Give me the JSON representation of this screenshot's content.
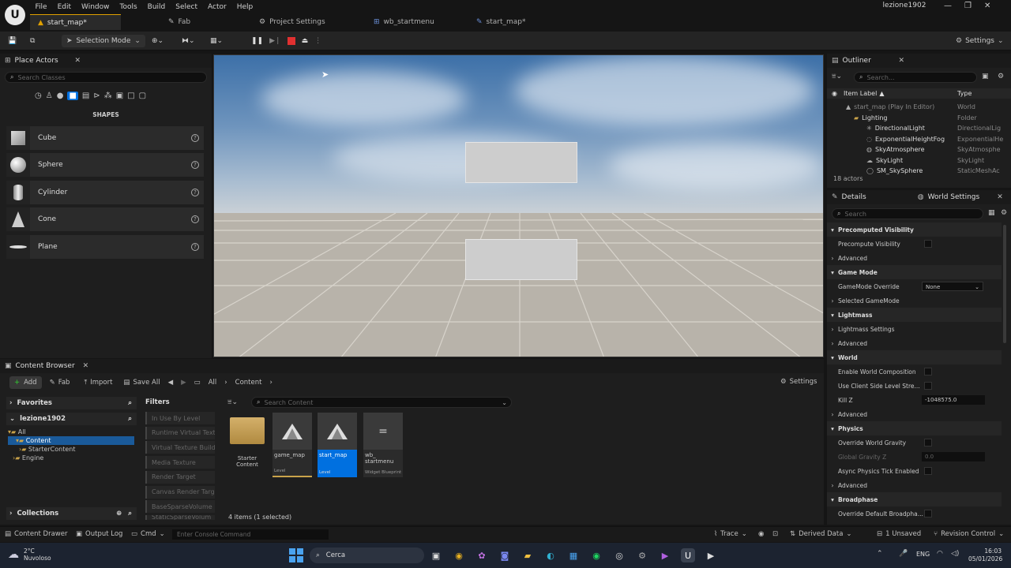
{
  "menu": [
    "File",
    "Edit",
    "Window",
    "Tools",
    "Build",
    "Select",
    "Actor",
    "Help"
  ],
  "project_name": "lezione1902",
  "tabs": [
    {
      "label": "start_map*",
      "icon": "level-icon"
    },
    {
      "label": "Fab",
      "icon": "fab-icon"
    },
    {
      "label": "Project Settings",
      "icon": "gear-icon"
    },
    {
      "label": "wb_startmenu",
      "icon": "widget-icon"
    },
    {
      "label": "start_map*",
      "icon": "level-icon"
    }
  ],
  "toolbar": {
    "selection_mode": "Selection Mode",
    "settings": "Settings"
  },
  "place_actors": {
    "title": "Place Actors",
    "search_placeholder": "Search Classes",
    "category": "SHAPES",
    "shapes": [
      "Cube",
      "Sphere",
      "Cylinder",
      "Cone",
      "Plane"
    ]
  },
  "outliner": {
    "title": "Outliner",
    "search_placeholder": "Search...",
    "col_label": "Item Label",
    "col_type": "Type",
    "rows": [
      {
        "label": "start_map (Play In Editor)",
        "type": "World"
      },
      {
        "label": "Lighting",
        "type": "Folder"
      },
      {
        "label": "DirectionalLight",
        "type": "DirectionalLig"
      },
      {
        "label": "ExponentialHeightFog",
        "type": "ExponentialHe"
      },
      {
        "label": "SkyAtmosphere",
        "type": "SkyAtmosphe"
      },
      {
        "label": "SkyLight",
        "type": "SkyLight"
      },
      {
        "label": "SM_SkySphere",
        "type": "StaticMeshAc"
      }
    ],
    "count": "18 actors"
  },
  "details": {
    "tab1": "Details",
    "tab2": "World Settings",
    "search_placeholder": "Search",
    "rows": [
      {
        "kind": "section",
        "label": "Precomputed Visibility"
      },
      {
        "kind": "check",
        "label": "Precompute Visibility"
      },
      {
        "kind": "sub",
        "label": "Advanced"
      },
      {
        "kind": "section",
        "label": "Game Mode"
      },
      {
        "kind": "select",
        "label": "GameMode Override",
        "value": "None"
      },
      {
        "kind": "sub",
        "label": "Selected GameMode"
      },
      {
        "kind": "section",
        "label": "Lightmass"
      },
      {
        "kind": "sub",
        "label": "Lightmass Settings"
      },
      {
        "kind": "sub",
        "label": "Advanced"
      },
      {
        "kind": "section",
        "label": "World"
      },
      {
        "kind": "check",
        "label": "Enable World Composition"
      },
      {
        "kind": "check",
        "label": "Use Client Side Level Stre..."
      },
      {
        "kind": "value",
        "label": "Kill Z",
        "value": "-1048575.0"
      },
      {
        "kind": "sub",
        "label": "Advanced"
      },
      {
        "kind": "section",
        "label": "Physics"
      },
      {
        "kind": "check",
        "label": "Override World Gravity"
      },
      {
        "kind": "value",
        "label": "Global Gravity Z",
        "value": "0.0",
        "disabled": true
      },
      {
        "kind": "check",
        "label": "Async Physics Tick Enabled"
      },
      {
        "kind": "sub",
        "label": "Advanced"
      },
      {
        "kind": "section",
        "label": "Broadphase"
      },
      {
        "kind": "check",
        "label": "Override Default Broadpha..."
      }
    ]
  },
  "content_browser": {
    "title": "Content Browser",
    "add": "Add",
    "fab": "Fab",
    "import": "Import",
    "save_all": "Save All",
    "path": [
      "All",
      "Content"
    ],
    "settings": "Settings",
    "favorites": "Favorites",
    "project": "lezione1902",
    "tree": [
      "All",
      "Content",
      "StarterContent",
      "Engine"
    ],
    "collections": "Collections",
    "filters_title": "Filters",
    "filters": [
      "In Use By Level",
      "Runtime Virtual Text",
      "Virtual Texture Build",
      "Media Texture",
      "Render Target",
      "Canvas Render Targ",
      "BaseSparseVolume",
      "StaticSparseVolum"
    ],
    "search_placeholder": "Search Content",
    "assets": [
      {
        "name": "Starter Content",
        "type": ""
      },
      {
        "name": "game_map",
        "type": "Level"
      },
      {
        "name": "start_map",
        "type": "Level"
      },
      {
        "name": "wb_ startmenu",
        "type": "Widget Blueprint"
      }
    ],
    "item_count": "4 items (1 selected)"
  },
  "statusbar": {
    "content_drawer": "Content Drawer",
    "output_log": "Output Log",
    "cmd": "Cmd",
    "console_placeholder": "Enter Console Command",
    "trace": "Trace",
    "derived_data": "Derived Data",
    "unsaved": "1 Unsaved",
    "revision_control": "Revision Control"
  },
  "taskbar": {
    "temp": "2°C",
    "weather": "Nuvoloso",
    "search": "Cerca",
    "lang": "ENG",
    "time": "16:03",
    "date": "05/01/2026"
  },
  "colors": {
    "accent": "#0070e0",
    "tab_highlight": "#e0a000",
    "stop": "#e03030"
  }
}
